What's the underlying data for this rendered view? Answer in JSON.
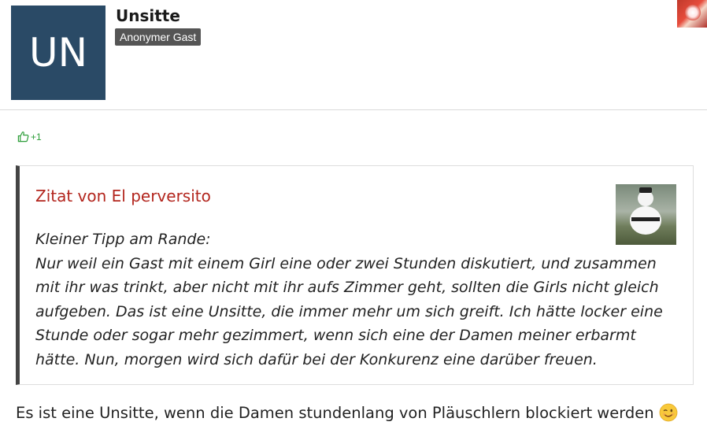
{
  "post": {
    "avatar_initials": "UN",
    "avatar_color": "#2a4a66",
    "username": "Unsitte",
    "role": "Anonymer Gast"
  },
  "like": {
    "icon": "thumbs-up-icon",
    "count": "+1",
    "color": "#2e9e3a"
  },
  "quote": {
    "author_label": "Zitat von El perversito",
    "author_color": "#b3261e",
    "lines": [
      "Kleiner Tipp am Rande:",
      "Nur weil ein Gast mit einem Girl eine oder zwei Stunden diskutiert, und zusammen mit ihr was trinkt, aber nicht mit ihr aufs Zimmer geht, sollten die Girls nicht gleich aufgeben. Das ist eine Unsitte, die immer mehr um sich greift. Ich hätte locker eine Stunde oder sogar mehr gezimmert, wenn sich eine der Damen meiner erbarmt hätte. Nun, morgen wird sich dafür bei der Konkurenz eine darüber freuen."
    ]
  },
  "reply": {
    "text": "Es ist eine Unsitte, wenn die Damen stundenlang von Pläuschlern blockiert werden",
    "emoji": "wink-emoji-icon"
  }
}
